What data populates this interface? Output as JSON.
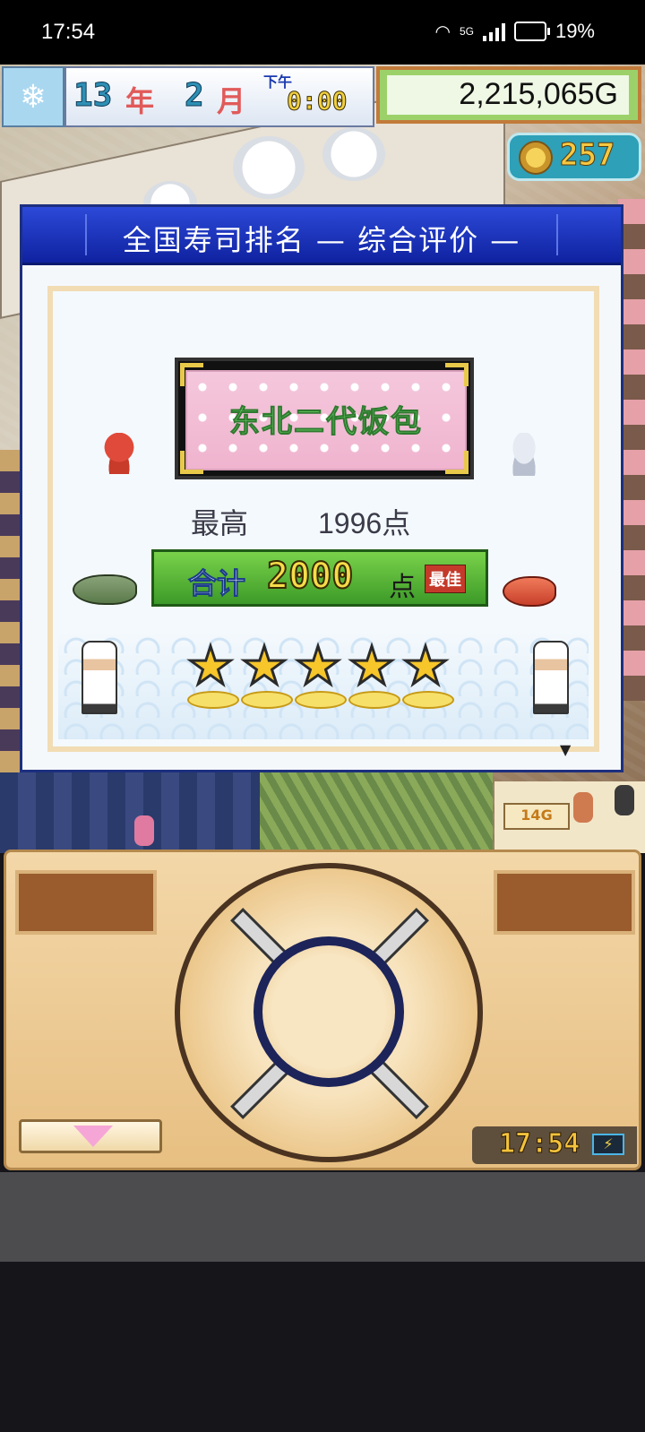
{
  "status_bar": {
    "time": "17:54",
    "network": "5G",
    "battery": "19%"
  },
  "hud": {
    "year_num": "13",
    "year_unit": "年",
    "month_num": "2",
    "month_unit": "月",
    "period": "下午",
    "clock": "0:00",
    "money": "2,215,065G",
    "medals": "257"
  },
  "dialog": {
    "title": "全国寿司排名 — 综合评价 —",
    "shop_name": "东北二代饭包",
    "best_label": "最高",
    "best_value": "1996点",
    "total_label": "合计",
    "total_value": "2000",
    "total_unit": "点",
    "best_badge": "最佳",
    "stars": 5,
    "star_glyph": "★"
  },
  "scene": {
    "price_tag": "14G"
  },
  "controller": {
    "clock": "17:54",
    "battery_icon": "charging-battery-icon"
  },
  "colors": {
    "dialog_header": "#1a33c4",
    "money_panel": "#9cd16a",
    "star": "#f6c62a",
    "total_bar": "#5cb838"
  }
}
